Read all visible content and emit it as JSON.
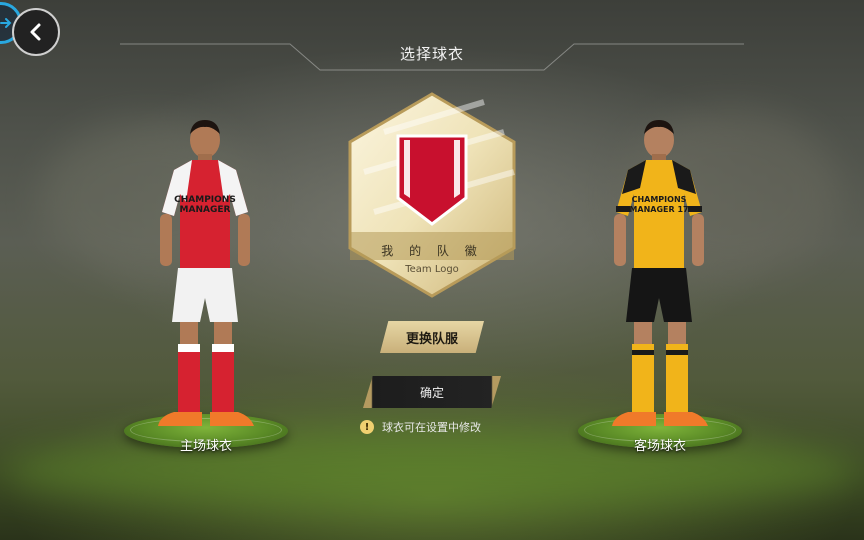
{
  "header": {
    "title": "选择球衣"
  },
  "nav": {
    "back_icon": "chevron-left-icon",
    "side_icon": "arrow-right-icon"
  },
  "logo": {
    "name": "我 的 队 徽",
    "subtitle": "Team Logo",
    "badge_color": "#c8102e"
  },
  "buttons": {
    "change_kit": "更换队服",
    "confirm": "确定"
  },
  "hint": {
    "icon": "warning-icon",
    "text": "球衣可在设置中修改"
  },
  "kits": {
    "home": {
      "label": "主场球衣",
      "shirt_text": "CHAMPIONS MANAGER",
      "shirt_color": "#d62230",
      "sleeve_color": "#ffffff",
      "shorts_color": "#ffffff",
      "socks_color": "#d62230"
    },
    "away": {
      "label": "客场球衣",
      "shirt_text": "CHAMPIONS MANAGER 17",
      "shirt_color": "#f1b41a",
      "sleeve_color": "#1a1a1a",
      "shorts_color": "#151515",
      "socks_color": "#f1b41a"
    }
  },
  "colors": {
    "accent_gold": "#c9b07a",
    "pitch_green": "#6ea034",
    "ring_blue": "#29a8e0"
  }
}
